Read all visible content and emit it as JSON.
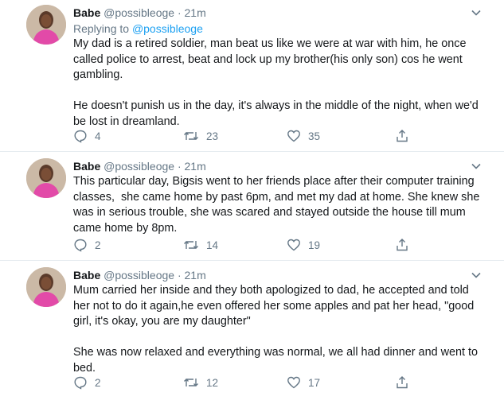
{
  "tweets": [
    {
      "name": "Babe",
      "handle": "@possibleoge",
      "dot": "·",
      "time": "21m",
      "replying_prefix": "Replying to",
      "replying_to": "@possibleoge",
      "text": "My dad is a retired soldier, man beat us like we were at war with him, he once called police to arrest, beat and lock up my brother(his only son) cos he went gambling.\n\nHe doesn't punish us in the day, it's always in the middle of the night, when we'd be lost in dreamland.",
      "replies": "4",
      "retweets": "23",
      "likes": "35"
    },
    {
      "name": "Babe",
      "handle": "@possibleoge",
      "dot": "·",
      "time": "21m",
      "text": "This particular day, Bigsis went to her friends place after their computer training classes,  she came home by past 6pm, and met my dad at home. She knew she was in serious trouble, she was scared and stayed outside the house till mum came home by 8pm.",
      "replies": "2",
      "retweets": "14",
      "likes": "19"
    },
    {
      "name": "Babe",
      "handle": "@possibleoge",
      "dot": "·",
      "time": "21m",
      "text": "Mum carried her inside and they both apologized to dad, he accepted and told her not to do it again,he even offered her some apples and pat her head, \"good girl, it's okay, you are my daughter\"\n\nShe was now relaxed and everything was normal, we all had dinner and went to bed.",
      "replies": "2",
      "retweets": "12",
      "likes": "17"
    }
  ],
  "colors": {
    "text": "#14171a",
    "secondary": "#657786",
    "link": "#1da1f2",
    "divider": "#e6ecf0"
  },
  "icons": [
    "chevron-down-icon",
    "reply-icon",
    "retweet-icon",
    "like-icon",
    "share-icon"
  ]
}
